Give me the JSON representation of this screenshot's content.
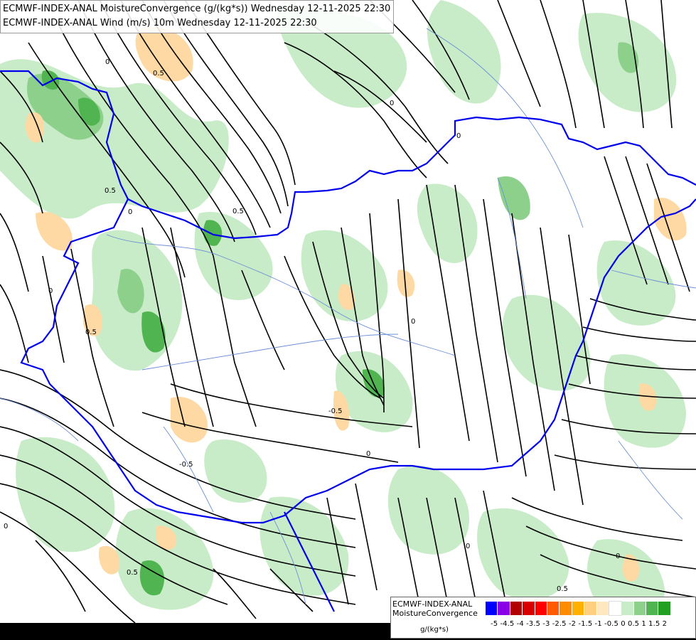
{
  "titles": {
    "line1": "ECMWF-INDEX-ANAL MoistureConvergence (g/(kg*s)) Wednesday 12-11-2025 22:30",
    "line2": "ECMWF-INDEX-ANAL Wind (m/s) 10m Wednesday 12-11-2025 22:30"
  },
  "legend": {
    "line1": "ECMWF-INDEX-ANAL",
    "line2": "MoistureConvergence",
    "unit": "g/(kg*s)",
    "ticks": "-5 -4.5 -4 -3.5 -3 -2.5 -2 -1.5 -1 -0.5  0  0.5  1  1.5  2",
    "colors": [
      "#0000ff",
      "#8a00e6",
      "#b00000",
      "#d80000",
      "#ff0000",
      "#ff5a00",
      "#ff8c00",
      "#ffb000",
      "#ffd080",
      "#ffe8c0",
      "#ffffff",
      "#c8ebc8",
      "#8cd08c",
      "#50b450",
      "#22a022"
    ]
  },
  "contour_labels": [
    "0.5",
    "0",
    "0.5",
    "0",
    "0.5",
    "0",
    "-0.5",
    "0",
    "0.5",
    "0",
    "0",
    "-0.5",
    "0",
    "0.5",
    "0",
    "0",
    "0.5",
    "0"
  ],
  "map_colors": {
    "light_green": "#c8ebc8",
    "mid_green": "#8cd08c",
    "dark_green": "#50b450",
    "orange": "#ffd9a3",
    "border_blue": "#0000ee",
    "river_blue": "#6b8fd6"
  }
}
